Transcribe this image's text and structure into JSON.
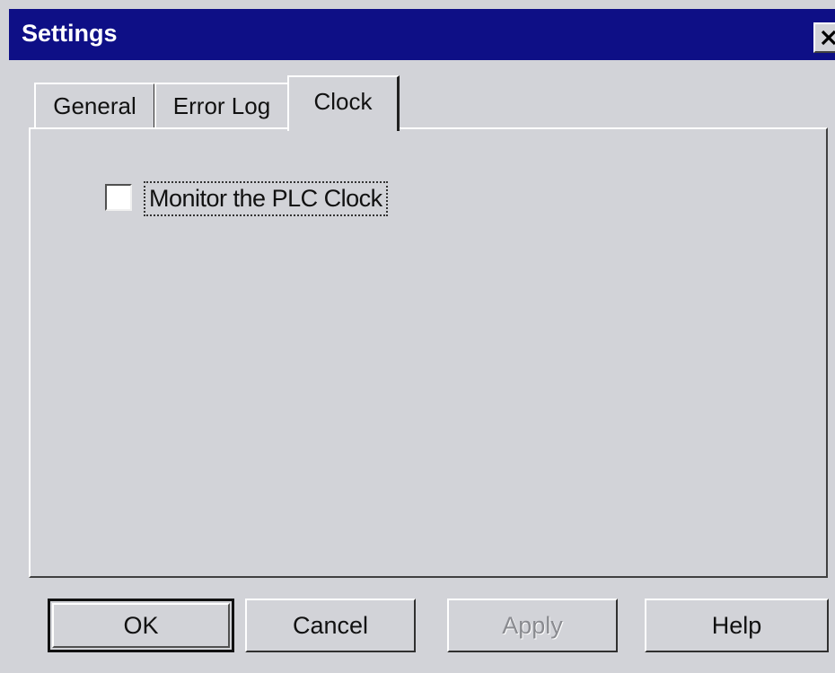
{
  "window": {
    "title": "Settings",
    "close_icon": "close-icon"
  },
  "tabs": [
    {
      "label": "General",
      "selected": false
    },
    {
      "label": "Error Log",
      "selected": false
    },
    {
      "label": "Clock",
      "selected": true
    }
  ],
  "clock_panel": {
    "monitor_checkbox_label": "Monitor the PLC Clock",
    "monitor_checked": false
  },
  "buttons": {
    "ok": "OK",
    "cancel": "Cancel",
    "apply": "Apply",
    "help": "Help"
  },
  "colors": {
    "titlebar": "#0e0f86",
    "face": "#d2d3d8",
    "disabled_text": "#8a8b90"
  }
}
